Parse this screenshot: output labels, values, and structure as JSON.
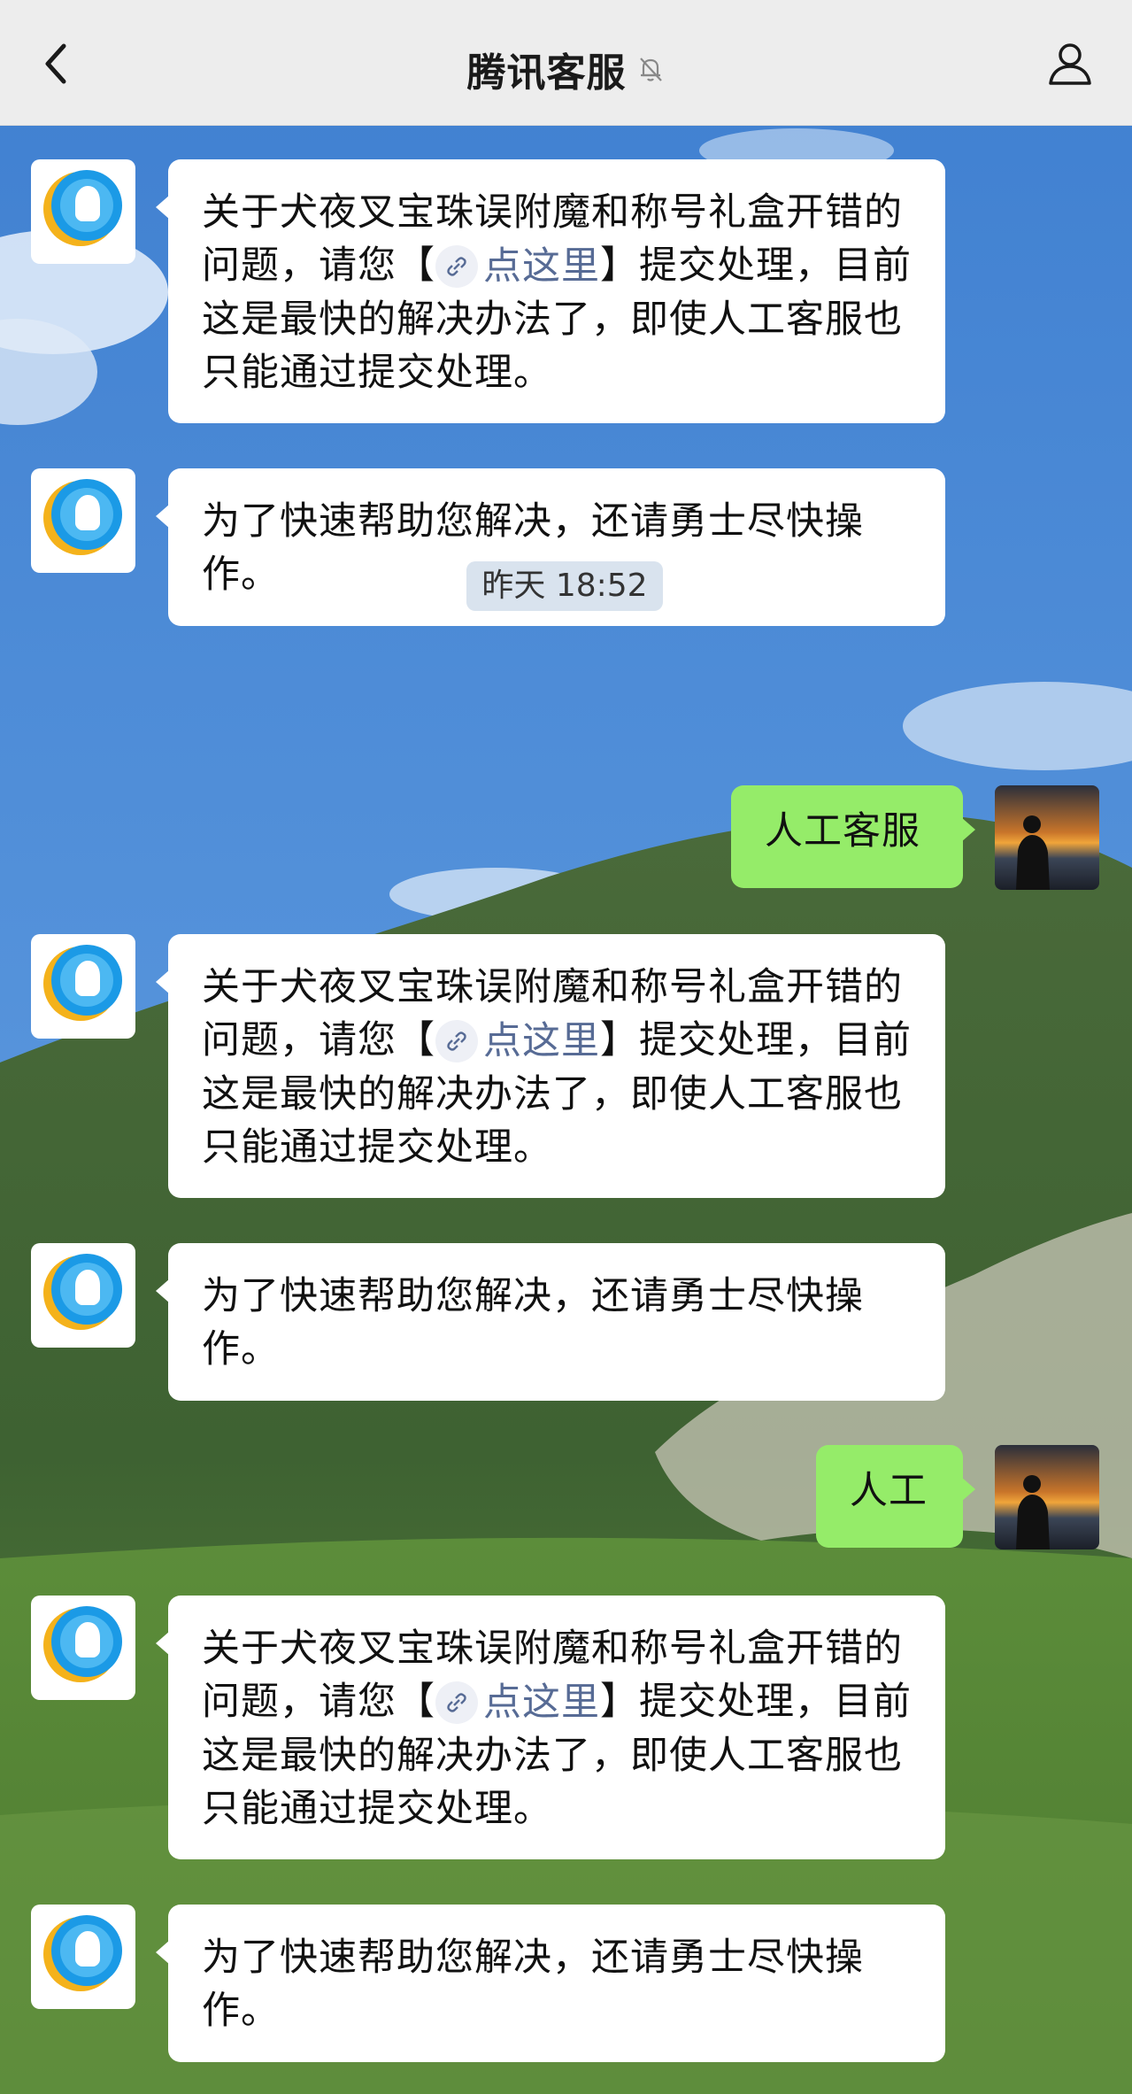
{
  "header": {
    "title": "腾讯客服",
    "back_icon": "chevron-left-icon",
    "mute_icon": "bell-off-icon",
    "profile_icon": "person-icon"
  },
  "timestamp": "昨天 18:52",
  "link_text": "点这里",
  "messages": {
    "long_a": "关于犬夜叉宝珠误附魔和称号礼盒开错的问题，请您【",
    "long_b": "】提交处理，目前这是最快的解决办法了，即使人工客服也只能通过提交处理。",
    "short": "为了快速帮助您解决，还请勇士尽快操作。",
    "user_1": "人工客服",
    "user_2": "人工"
  },
  "colors": {
    "nav_bg": "#ededed",
    "bubble_bot": "#ffffff",
    "bubble_user": "#95ec69",
    "link": "#576b95"
  }
}
